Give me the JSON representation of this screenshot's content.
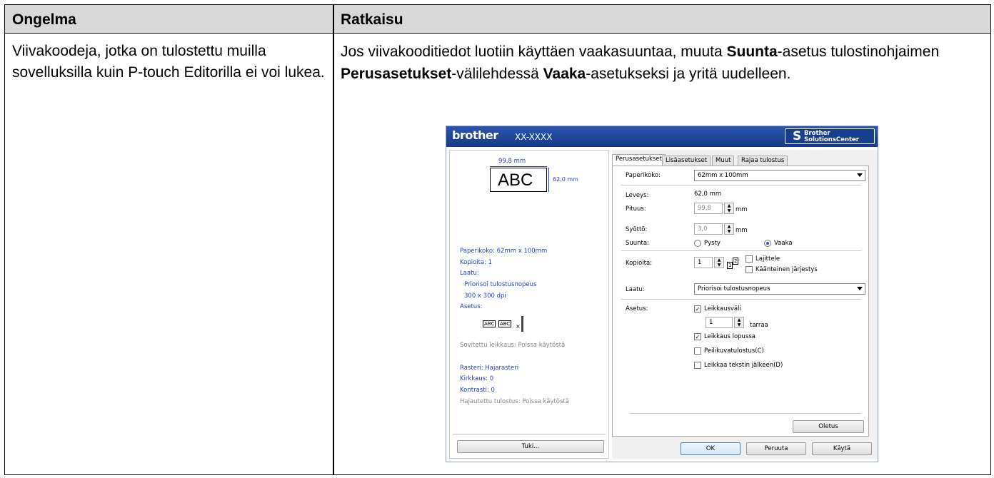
{
  "table": {
    "header": {
      "col1": "Ongelma",
      "col2": "Ratkaisu"
    },
    "problem": "Viivakoodeja, jotka on tulostettu muilla sovelluksilla kuin P-touch Editorilla ei voi lukea.",
    "solution": {
      "t1": "Jos viivakooditiedot luotiin käyttäen vaakasuuntaa, muuta ",
      "b1": "Suunta",
      "t2": "-asetus tulostinohjaimen ",
      "b2": "Perusasetukset",
      "t3": "-välilehdessä ",
      "b3": "Vaaka",
      "t4": "-asetukseksi ja yritä uudelleen."
    }
  },
  "dialog": {
    "logo": "brother",
    "model": "XX-XXXX",
    "bsc_brand": "Brother",
    "bsc_center": "SolutionsCenter",
    "preview": {
      "width_dim": "99,8 mm",
      "height_dim": "62,0 mm",
      "sample": "ABC",
      "paper": "Paperikoko: 62mm x 100mm",
      "copies": "Kopioita: 1",
      "quality_h": "Laatu:",
      "quality_1": "Priorisoi tulostusnopeus",
      "quality_2": "300 x 300 dpi",
      "setting_h": "Asetus:",
      "mini_abc": "ABC",
      "cut": "Sovitettu leikkaus: Poissa käytöstä",
      "raster": "Rasteri: Hajarasteri",
      "brightness": "Kirkkaus:  0",
      "contrast": "Kontrasti:  0",
      "distributed": "Hajautettu tulostus: Poissa käytöstä",
      "support_btn": "Tuki..."
    },
    "tabs": [
      "Perusasetukset",
      "Lisäasetukset",
      "Muut",
      "Rajaa tulostus"
    ],
    "basic": {
      "paper_label": "Paperikoko:",
      "paper_value": "62mm x 100mm",
      "width_label": "Leveys:",
      "width_value": "62,0 mm",
      "length_label": "Pituus:",
      "length_value": "99,8",
      "unit_mm": "mm",
      "feed_label": "Syöttö:",
      "feed_value": "3,0",
      "orient_label": "Suunta:",
      "portrait": "Pysty",
      "landscape": "Vaaka",
      "copies_label": "Kopioita:",
      "copies_value": "1",
      "collate": "Lajittele",
      "reverse": "Käänteinen järjestys",
      "quality_label": "Laatu:",
      "quality_value": "Priorisoi tulostusnopeus",
      "setting_label": "Asetus:",
      "cut_interval": "Leikkausväli",
      "cut_count": "1",
      "labels_unit": "tarraa",
      "cut_at_end": "Leikkaus lopussa",
      "mirror": "Peilikuvatulostus(C)",
      "cut_after_text": "Leikkaa tekstin jälkeen(D)",
      "default_btn": "Oletus"
    },
    "footer": {
      "ok": "OK",
      "cancel": "Peruuta",
      "apply": "Käytä"
    }
  }
}
